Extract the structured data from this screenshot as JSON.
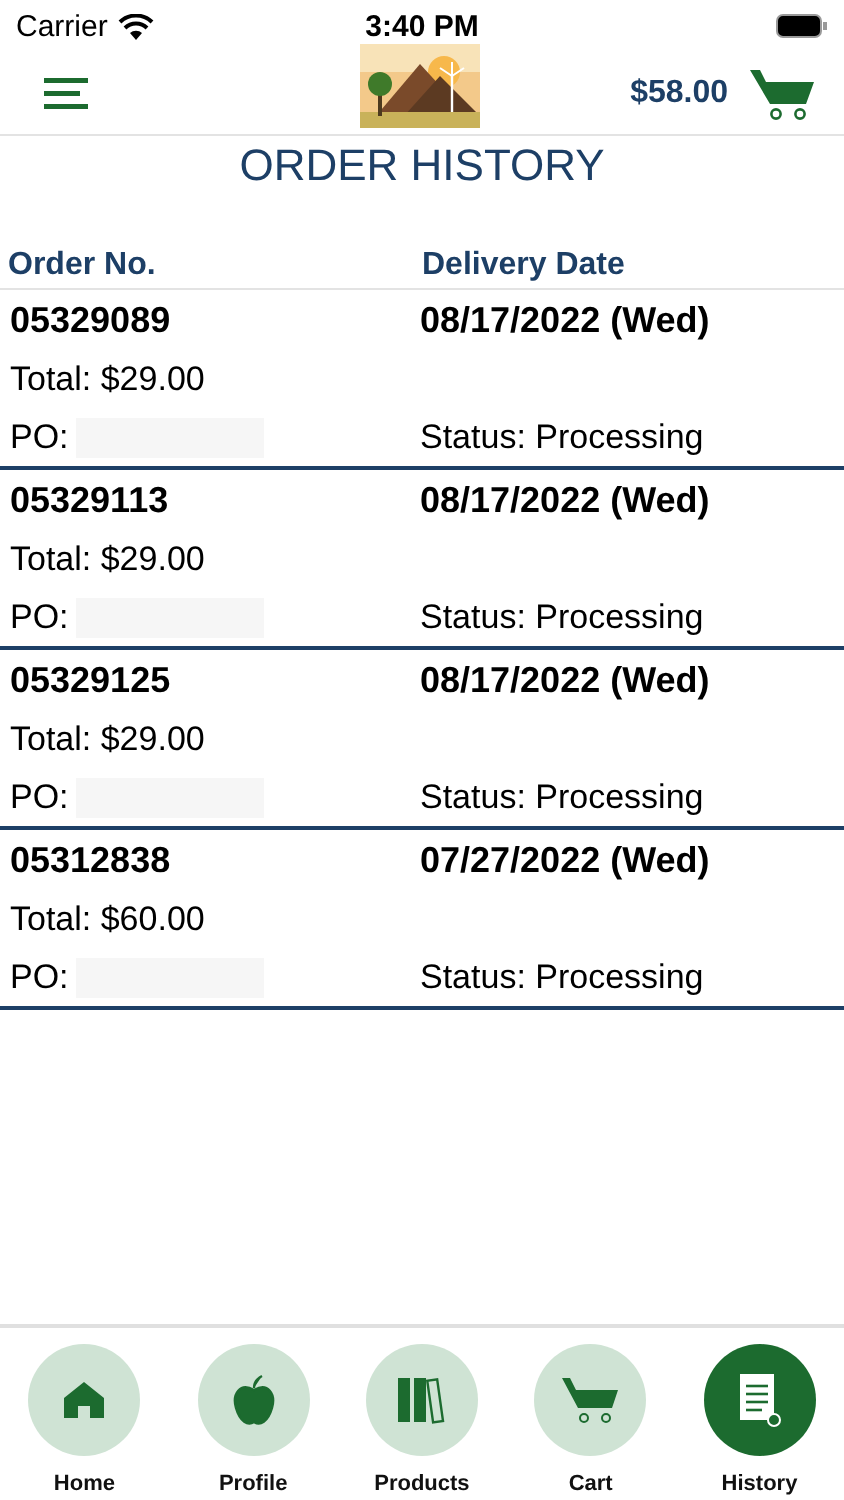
{
  "status_bar": {
    "carrier": "Carrier",
    "time": "3:40 PM"
  },
  "header": {
    "cart_total": "$58.00"
  },
  "title": "ORDER HISTORY",
  "columns": [
    "Order No.",
    "Delivery Date"
  ],
  "orders": [
    {
      "number": "05329089",
      "date": "08/17/2022 (Wed)",
      "total": "Total: $29.00",
      "po_label": "PO:",
      "status": "Status: Processing"
    },
    {
      "number": "05329113",
      "date": "08/17/2022 (Wed)",
      "total": "Total: $29.00",
      "po_label": "PO:",
      "status": "Status: Processing"
    },
    {
      "number": "05329125",
      "date": "08/17/2022 (Wed)",
      "total": "Total: $29.00",
      "po_label": "PO:",
      "status": "Status: Processing"
    },
    {
      "number": "05312838",
      "date": "07/27/2022 (Wed)",
      "total": "Total: $60.00",
      "po_label": "PO:",
      "status": "Status: Processing"
    }
  ],
  "tabs": [
    {
      "kind": "home",
      "label": "Home",
      "selected": false
    },
    {
      "kind": "profile",
      "label": "Profile",
      "selected": false
    },
    {
      "kind": "products",
      "label": "Products",
      "selected": false
    },
    {
      "kind": "cart",
      "label": "Cart",
      "selected": false
    },
    {
      "kind": "history",
      "label": "History",
      "selected": true
    }
  ]
}
